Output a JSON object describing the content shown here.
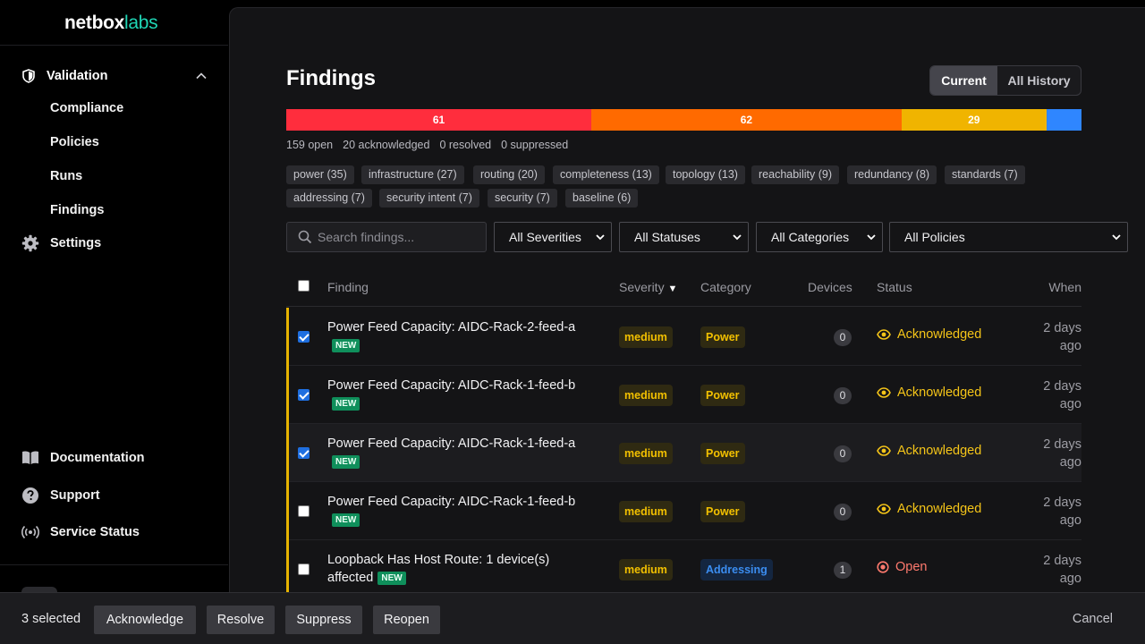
{
  "brand": {
    "part1": "netbox",
    "part2": "labs",
    "accent_color": "#1fd6b5"
  },
  "sidebar": {
    "group": {
      "label": "Validation",
      "icon": "shield-icon",
      "expanded": true
    },
    "sub_items": [
      {
        "label": "Compliance"
      },
      {
        "label": "Policies"
      },
      {
        "label": "Runs"
      },
      {
        "label": "Findings"
      }
    ],
    "settings": {
      "label": "Settings",
      "icon": "gear-icon"
    },
    "footer": [
      {
        "label": "Documentation",
        "icon": "book-icon"
      },
      {
        "label": "Support",
        "icon": "help-icon"
      },
      {
        "label": "Service Status",
        "icon": "broadcast-icon"
      }
    ]
  },
  "page": {
    "title": "Findings",
    "view_toggle": {
      "current": "Current",
      "history": "All History",
      "selected": "Current"
    }
  },
  "severity_bar": {
    "segments": [
      {
        "label": "61",
        "value": 61,
        "color": "#ff2d3d"
      },
      {
        "label": "62",
        "value": 62,
        "color": "#ff6a00"
      },
      {
        "label": "29",
        "value": 29,
        "color": "#f0b400"
      },
      {
        "label": "",
        "value": 7,
        "color": "#2f86ff"
      }
    ]
  },
  "summary": {
    "open": "159 open",
    "acknowledged": "20 acknowledged",
    "resolved": "0 resolved",
    "suppressed": "0 suppressed"
  },
  "category_chips": [
    "power (35)",
    "infrastructure (27)",
    "routing (20)",
    "completeness (13)",
    "topology (13)",
    "reachability (9)",
    "redundancy (8)",
    "standards (7)",
    "addressing (7)",
    "security intent (7)",
    "security (7)",
    "baseline (6)"
  ],
  "filters": {
    "search_placeholder": "Search findings...",
    "severity": "All Severities",
    "status": "All Statuses",
    "category": "All Categories",
    "policy": "All Policies"
  },
  "table": {
    "columns": {
      "finding": "Finding",
      "severity": "Severity",
      "sort_indicator": "▼",
      "category": "Category",
      "devices": "Devices",
      "status": "Status",
      "when": "When"
    },
    "rows": [
      {
        "checked": true,
        "title": "Power Feed Capacity: AIDC-Rack-2-feed-a",
        "new_label": "NEW",
        "severity": "medium",
        "category": "Power",
        "devices": "0",
        "status": "Acknowledged",
        "when": "2 days ago"
      },
      {
        "checked": true,
        "title": "Power Feed Capacity: AIDC-Rack-1-feed-b",
        "new_label": "NEW",
        "severity": "medium",
        "category": "Power",
        "devices": "0",
        "status": "Acknowledged",
        "when": "2 days ago"
      },
      {
        "checked": true,
        "title": "Power Feed Capacity: AIDC-Rack-1-feed-a",
        "new_label": "NEW",
        "severity": "medium",
        "category": "Power",
        "devices": "0",
        "status": "Acknowledged",
        "when": "2 days ago"
      },
      {
        "checked": false,
        "title": "Power Feed Capacity: AIDC-Rack-1-feed-b",
        "new_label": "NEW",
        "severity": "medium",
        "category": "Power",
        "devices": "0",
        "status": "Acknowledged",
        "when": "2 days ago"
      },
      {
        "checked": false,
        "title": "Loopback Has Host Route: 1 device(s) affected",
        "new_label": "NEW",
        "severity": "medium",
        "category": "Addressing",
        "devices": "1",
        "status": "Open",
        "when": "2 days ago"
      }
    ]
  },
  "bulk_bar": {
    "selected_text": "3 selected",
    "acknowledge": "Acknowledge",
    "resolve": "Resolve",
    "suppress": "Suppress",
    "reopen": "Reopen",
    "cancel": "Cancel"
  },
  "colors": {
    "acknowledged": "#f5c518",
    "open": "#ff7a6e",
    "severity_medium": "#f2c000",
    "category_addressing": "#3b8df0"
  }
}
